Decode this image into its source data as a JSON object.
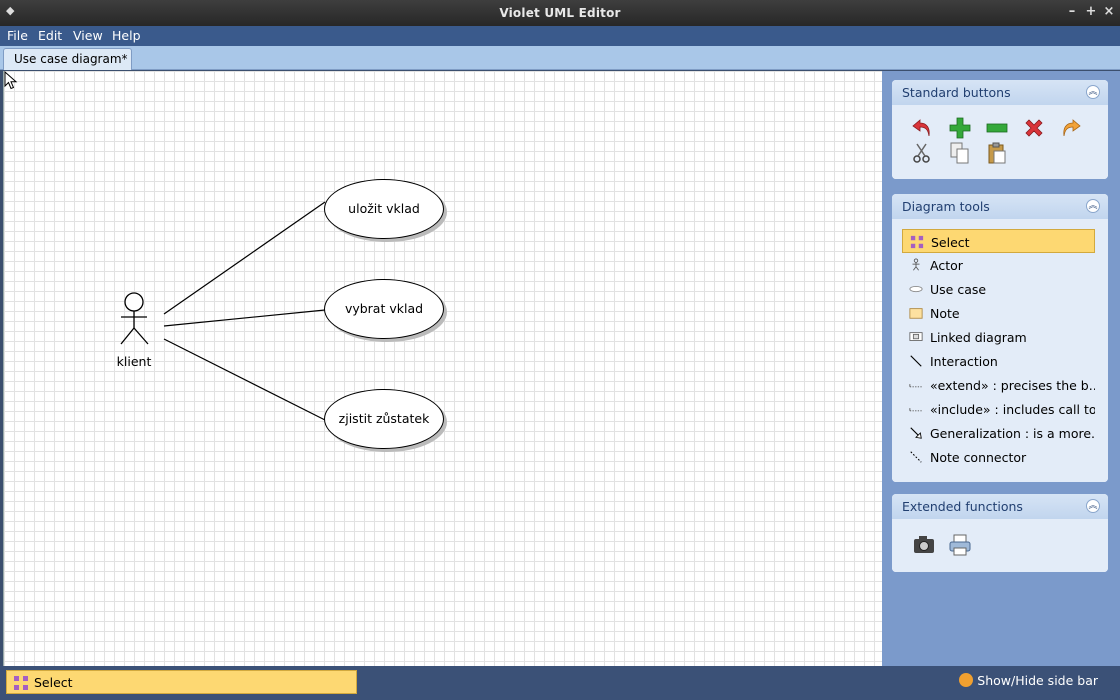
{
  "window": {
    "title": "Violet UML Editor",
    "menu_glyph": "◆",
    "minimize": "–",
    "maximize": "+",
    "close": "×"
  },
  "menubar": {
    "file": "File",
    "edit": "Edit",
    "view": "View",
    "help": "Help"
  },
  "tabs": [
    {
      "label": "Use case diagram*"
    }
  ],
  "diagram": {
    "actor": {
      "name": "klient"
    },
    "use_cases": [
      {
        "label": "uložit vklad"
      },
      {
        "label": "vybrat vklad"
      },
      {
        "label": "zjistit zůstatek"
      }
    ]
  },
  "sidebar": {
    "standard_buttons": {
      "title": "Standard buttons",
      "buttons": [
        "undo-icon",
        "add-icon",
        "remove-icon",
        "delete-icon",
        "redo-icon",
        "cut-icon",
        "copy-icon",
        "paste-icon"
      ]
    },
    "diagram_tools": {
      "title": "Diagram tools",
      "tools": [
        {
          "label": "Select",
          "icon": "select-icon"
        },
        {
          "label": "Actor",
          "icon": "actor-icon"
        },
        {
          "label": "Use case",
          "icon": "use-case-icon"
        },
        {
          "label": "Note",
          "icon": "note-icon"
        },
        {
          "label": "Linked diagram",
          "icon": "linked-diagram-icon"
        },
        {
          "label": "Interaction",
          "icon": "interaction-icon"
        },
        {
          "label": "«extend» : precises the b...",
          "icon": "extend-icon"
        },
        {
          "label": "«include» : includes call to",
          "icon": "include-icon"
        },
        {
          "label": "Generalization : is a more...",
          "icon": "generalization-icon"
        },
        {
          "label": "Note connector",
          "icon": "note-connector-icon"
        }
      ]
    },
    "extended_functions": {
      "title": "Extended functions",
      "buttons": [
        "camera-icon",
        "print-icon"
      ]
    }
  },
  "statusbar": {
    "current_tool": "Select",
    "toggle_sidebar": "Show/Hide side bar"
  },
  "colors": {
    "menubar": "#3a5a8c",
    "sidebar": "#7b9acb",
    "selected_tool": "#fdd872"
  }
}
